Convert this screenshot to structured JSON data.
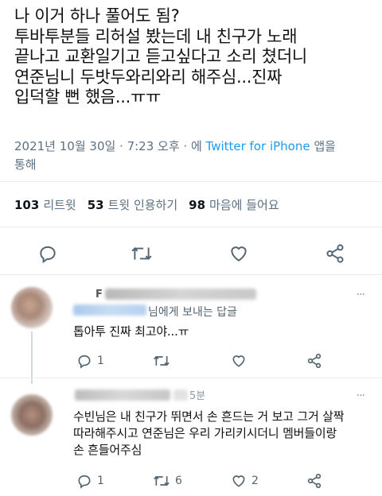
{
  "tweet": {
    "text": "나 이거 하나 풀어도 됨?\n투바투분들 리허설 봤는데 내 친구가 노래\n끝나고 교환일기고 듣고싶다고 소리 쳤더니\n연준님니 두밧두와리와리 해주심...진짜\n입덕할 뻔 했음...ㅠㅠ",
    "timestamp": "2021년 10월 30일 · 7:23 오후 · 에 ",
    "via": "Twitter for iPhone",
    "via_suffix": " 앱을",
    "via_suffix2": "통해"
  },
  "counts": {
    "retweets_num": "103",
    "retweets_label": "리트윗",
    "quotes_num": "53",
    "quotes_label": "트윗 인용하기",
    "likes_num": "98",
    "likes_label": "마음에 들어요"
  },
  "replies": [
    {
      "name_partial": "F",
      "reply_to_suffix": "님에게 보내는 답글",
      "text": "톱아투 진짜 최고야...ㅠ",
      "reply_count": "1",
      "retweet_count": "",
      "like_count": ""
    },
    {
      "time_partial": "5분",
      "text": "수빈님은 내 친구가 뛰면서 손 흔드는 거 보고 그거 살짝\n따라해주시고 연준님은 우리 가리키시더니 멤버들이랑\n손 흔들어주심",
      "reply_count": "1",
      "retweet_count": "6",
      "like_count": "2"
    }
  ],
  "colors": {
    "accent": "#1d9bf0",
    "muted": "#5b7083",
    "divider": "#e6ecf0"
  },
  "icons": [
    "comment-icon",
    "retweet-icon",
    "heart-icon",
    "share-icon",
    "more-icon"
  ]
}
